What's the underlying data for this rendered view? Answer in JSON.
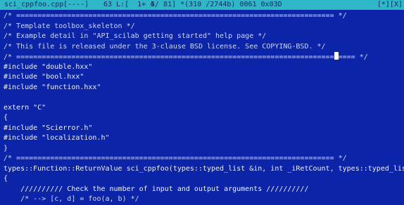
{
  "status_bar": {
    "filename": "sci_cppfoo.cpp",
    "flags": "[----]",
    "position": "63 L:[  1+ 4",
    "rest": "5/ 81] *(310 /2744b) 0061 0x03D",
    "corner": "[*][X]"
  },
  "lines": [
    "/* =========================================================================== */",
    "/* Template toolbox_skeleton */",
    "/* Example detail in \"API_scilab getting started\" help page */",
    "/* This file is released under the 3-clause BSD license. See COPYING-BSD. */",
    "/* ===========================================================================",
    "#include \"double.hxx\"",
    "#include \"bool.hxx\"",
    "#include \"function.hxx\"",
    "",
    "extern \"C\"",
    "{",
    "#include \"Scierror.h\"",
    "#include \"localization.h\"",
    "}",
    "/* =========================================================================== */",
    "types::Function::ReturnValue sci_cppfoo(types::typed_list &in, int _iRetCount, types::typed_list",
    "{",
    "    ////////// Check the number of input and output arguments //////////",
    "    /* --> [c, d] = foo(a, b) */"
  ],
  "cursor_line_tail": "==== */"
}
